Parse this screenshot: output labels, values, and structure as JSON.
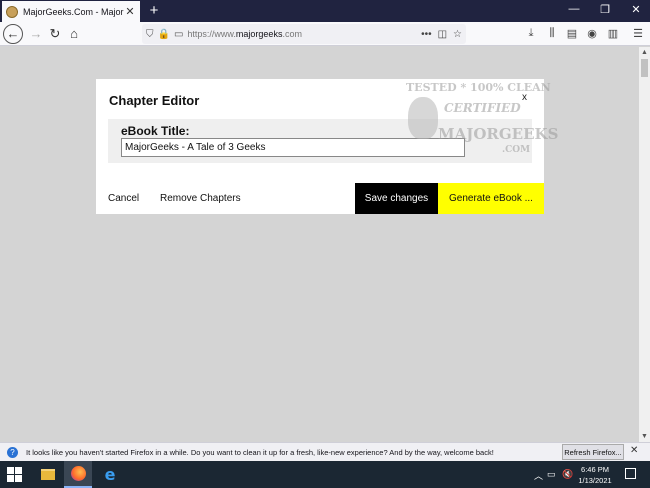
{
  "browser": {
    "tab": {
      "title": "MajorGeeks.Com - MajorGeeks",
      "favicon": "majorgeeks-favicon",
      "close": "✕"
    },
    "new_tab": "+",
    "window_controls": {
      "minimize": "—",
      "restore": "❐",
      "close": "✕"
    },
    "nav": {
      "back": "←",
      "forward": "→",
      "reload": "↻",
      "home": "⌂"
    },
    "url": {
      "prefix": "https://www.",
      "domain": "majorgeeks",
      "suffix": ".com"
    },
    "toolbar_icons": [
      "download-icon",
      "library-icon",
      "reader-icon",
      "account-icon",
      "extension-icon",
      "menu-icon"
    ]
  },
  "dialog": {
    "title": "Chapter Editor",
    "close": "x",
    "field_label": "eBook Title:",
    "field_value": "MajorGeeks - A Tale of 3 Geeks",
    "cancel": "Cancel",
    "remove": "Remove Chapters",
    "save": "Save changes",
    "generate": "Generate eBook ..."
  },
  "watermark": {
    "line1": "TESTED * 100% CLEAN",
    "line2": "CERTIFIED",
    "line3": "MAJORGEEKS",
    "line4": ".COM"
  },
  "notification": {
    "text": "It looks like you haven't started Firefox in a while. Do you want to clean it up for a fresh, like-new experience? And by the way, welcome back!",
    "button": "Refresh Firefox...",
    "close": "✕"
  },
  "taskbar": {
    "time": "6:46 PM",
    "date": "1/13/2021",
    "tray_icons": [
      "chevron-up-icon",
      "network-icon",
      "volume-mute-icon"
    ]
  },
  "colors": {
    "save_bg": "#000000",
    "generate_bg": "#ffff00",
    "page_bg": "#d4d4d4",
    "titlebar_bg": "#202340"
  }
}
